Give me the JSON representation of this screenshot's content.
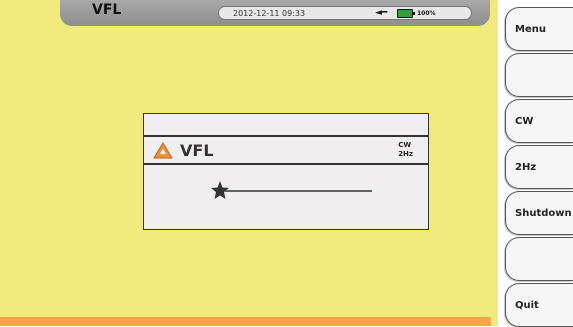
{
  "header": {
    "title": "VFL",
    "datetime": "2012-12-11 09:33",
    "power_icon": "plug-icon",
    "battery_icon": "battery-icon",
    "battery_percent": "100%"
  },
  "dialog": {
    "title": "VFL",
    "warning_icon": "warning-triangle-icon",
    "mode_line1": "CW",
    "mode_line2": "2Hz",
    "laser_icon": "laser-beam-icon"
  },
  "sidebar": {
    "buttons": [
      "Menu",
      "",
      "CW",
      "2Hz",
      "Shutdown",
      "",
      "Quit"
    ]
  },
  "colors": {
    "screen_bg": "#f0eb7c",
    "bottom_bar": "#f1a84a",
    "header_bg": "#999999",
    "battery_fill": "#2ba33b",
    "warning_orange": "#f0913a"
  }
}
